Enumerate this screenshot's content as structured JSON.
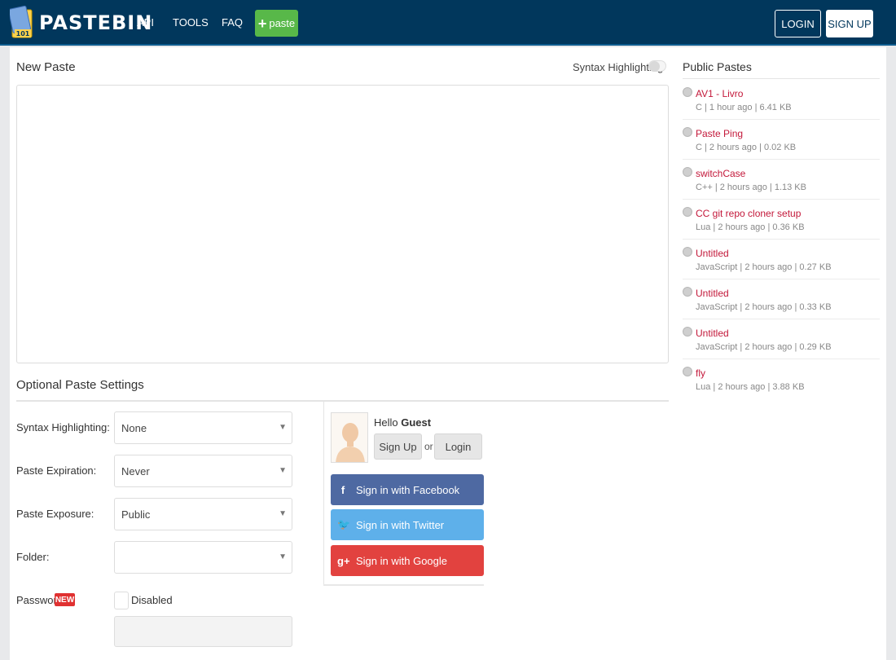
{
  "header": {
    "logo_text": "PASTEBIN",
    "nav": [
      "API",
      "TOOLS",
      "FAQ"
    ],
    "paste_button": "paste",
    "login": "LOGIN",
    "signup": "SIGN UP"
  },
  "editor": {
    "title": "New Paste",
    "syntax_toggle_label": "Syntax Highlighting"
  },
  "settings": {
    "title": "Optional Paste Settings",
    "syntax_label": "Syntax Highlighting:",
    "syntax_value": "None",
    "expiration_label": "Paste Expiration:",
    "expiration_value": "Never",
    "exposure_label": "Paste Exposure:",
    "exposure_value": "Public",
    "folder_label": "Folder:",
    "folder_value": "",
    "password_label": "Password",
    "password_badge": "NEW",
    "password_checkbox_label": "Disabled"
  },
  "guest": {
    "hello": "Hello",
    "name": "Guest",
    "signup": "Sign Up",
    "or": "or",
    "login": "Login",
    "facebook": "Sign in with Facebook",
    "twitter": "Sign in with Twitter",
    "google": "Sign in with Google"
  },
  "sidebar": {
    "title": "Public Pastes",
    "items": [
      {
        "title": "AV1 - Livro",
        "meta": "C | 1 hour ago | 6.41 KB"
      },
      {
        "title": "Paste Ping",
        "meta": "C | 2 hours ago | 0.02 KB"
      },
      {
        "title": "switchCase",
        "meta": "C++ | 2 hours ago | 1.13 KB"
      },
      {
        "title": "CC git repo cloner setup",
        "meta": "Lua | 2 hours ago | 0.36 KB"
      },
      {
        "title": "Untitled",
        "meta": "JavaScript | 2 hours ago | 0.27 KB"
      },
      {
        "title": "Untitled",
        "meta": "JavaScript | 2 hours ago | 0.33 KB"
      },
      {
        "title": "Untitled",
        "meta": "JavaScript | 2 hours ago | 0.29 KB"
      },
      {
        "title": "fly",
        "meta": "Lua | 2 hours ago | 3.88 KB"
      }
    ]
  },
  "colors": {
    "header_bg": "#01375c",
    "paste_green": "#58b849",
    "facebook": "#4e69a2",
    "twitter": "#5eb0ea",
    "google": "#e2423f",
    "link_red": "#c3183a"
  },
  "icons": {
    "logo": "pastebin-logo-icon",
    "plus": "plus-icon",
    "avatar": "user-avatar-icon",
    "facebook": "facebook-icon",
    "twitter": "twitter-icon",
    "google": "google-plus-icon",
    "globe": "globe-icon",
    "caret": "chevron-down-icon"
  }
}
